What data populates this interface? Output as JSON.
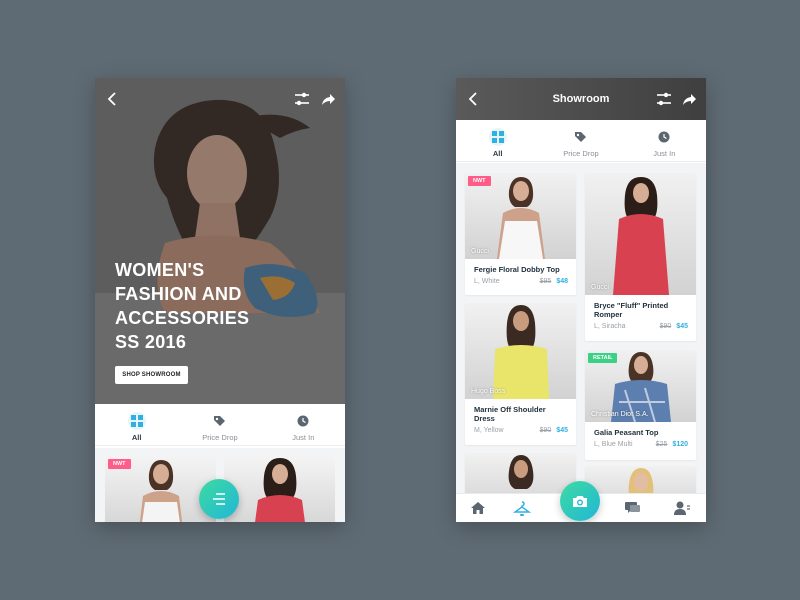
{
  "colors": {
    "background": "#5f6b74",
    "accent": "#2fb0e0",
    "fab_gradient_start": "#3ddba1",
    "fab_gradient_end": "#21b7d6",
    "badge_new": "#ff5c8a",
    "badge_retail": "#3ccf86",
    "price_new": "#2fb0e0"
  },
  "left": {
    "hero": {
      "title_lines": [
        "WOMEN'S",
        "FASHION AND",
        "ACCESSORIES",
        "SS 2016"
      ],
      "cta_label": "SHOP SHOWROOM"
    },
    "tabs": [
      {
        "label": "All",
        "icon": "grid-icon",
        "active": true
      },
      {
        "label": "Price Drop",
        "icon": "tag-icon",
        "active": false
      },
      {
        "label": "Just In",
        "icon": "clock-icon",
        "active": false
      }
    ],
    "preview_badge": "NWT"
  },
  "right": {
    "header": {
      "title": "Showroom"
    },
    "tabs": [
      {
        "label": "All",
        "icon": "grid-icon",
        "active": true
      },
      {
        "label": "Price Drop",
        "icon": "tag-icon",
        "active": false
      },
      {
        "label": "Just In",
        "icon": "clock-icon",
        "active": false
      }
    ],
    "products": [
      {
        "badge": "NWT",
        "brand": "Gucci",
        "name": "Fergie Floral Dobby Top",
        "variant": "L, White",
        "old_price": "$95",
        "new_price": "$48"
      },
      {
        "badge": "",
        "brand": "Gucci",
        "name": "Bryce \"Fluff\" Printed Romper",
        "variant": "L, Siracha",
        "old_price": "$90",
        "new_price": "$45"
      },
      {
        "badge": "",
        "brand": "Hugo Boss",
        "name": "Marnie Off Shoulder Dress",
        "variant": "M, Yellow",
        "old_price": "$90",
        "new_price": "$45"
      },
      {
        "badge": "RETAIL",
        "brand": "Christian Dior S.A.",
        "name": "Galia Peasant Top",
        "variant": "L, Blue Multi",
        "old_price": "$25",
        "new_price": "$120"
      }
    ],
    "bottom_nav": [
      {
        "icon": "home-icon"
      },
      {
        "icon": "hanger-icon",
        "active": true
      },
      {
        "icon": "camera-icon"
      },
      {
        "icon": "chat-icon"
      },
      {
        "icon": "profile-icon"
      }
    ]
  }
}
